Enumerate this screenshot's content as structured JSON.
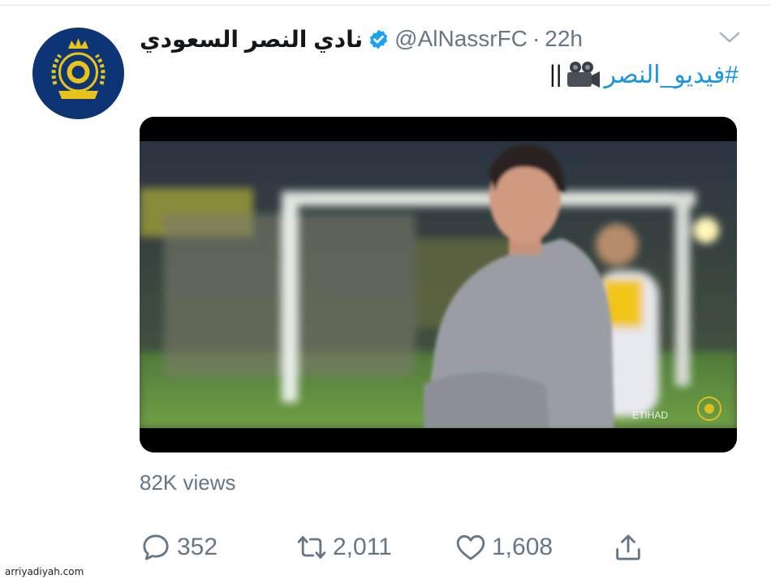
{
  "tweet": {
    "display_name": "نادي النصر السعودي",
    "handle": "@AlNassrFC",
    "separator": "·",
    "time": "22h",
    "text": {
      "hashtag": "#فيديو_النصر",
      "suffix": "||"
    },
    "views": "82K views",
    "actions": {
      "reply_count": "352",
      "retweet_count": "2,011",
      "like_count": "1,608"
    }
  },
  "icons": {
    "verified": "verified-badge-icon",
    "more": "chevron-down-icon",
    "camera": "movie-camera-emoji-icon",
    "reply": "reply-icon",
    "retweet": "retweet-icon",
    "like": "heart-icon",
    "share": "share-icon"
  },
  "colors": {
    "link": "#1b95e0",
    "secondary_text": "#657786",
    "avatar_bg": "#0d3576",
    "badge": "#1da1f2"
  },
  "watermark": "arriyadiyah.com"
}
